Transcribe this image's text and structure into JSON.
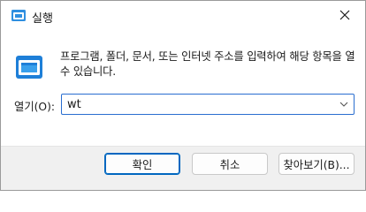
{
  "window": {
    "title": "실행",
    "icon": "run-app-icon",
    "close": "close-icon"
  },
  "dialog": {
    "description": "프로그램, 폴더, 문서, 또는 인터넷 주소를 입력하여 해당 항목을 열 수 있습니다.",
    "open_label": "열기(O):",
    "open_value": "wt",
    "icon": "run-icon"
  },
  "buttons": {
    "ok": "확인",
    "cancel": "취소",
    "browse": "찾아보기(B)..."
  },
  "colors": {
    "accent": "#0067c0",
    "focus_border": "#2a6ed0",
    "footer_bg": "#f0f0f0"
  }
}
